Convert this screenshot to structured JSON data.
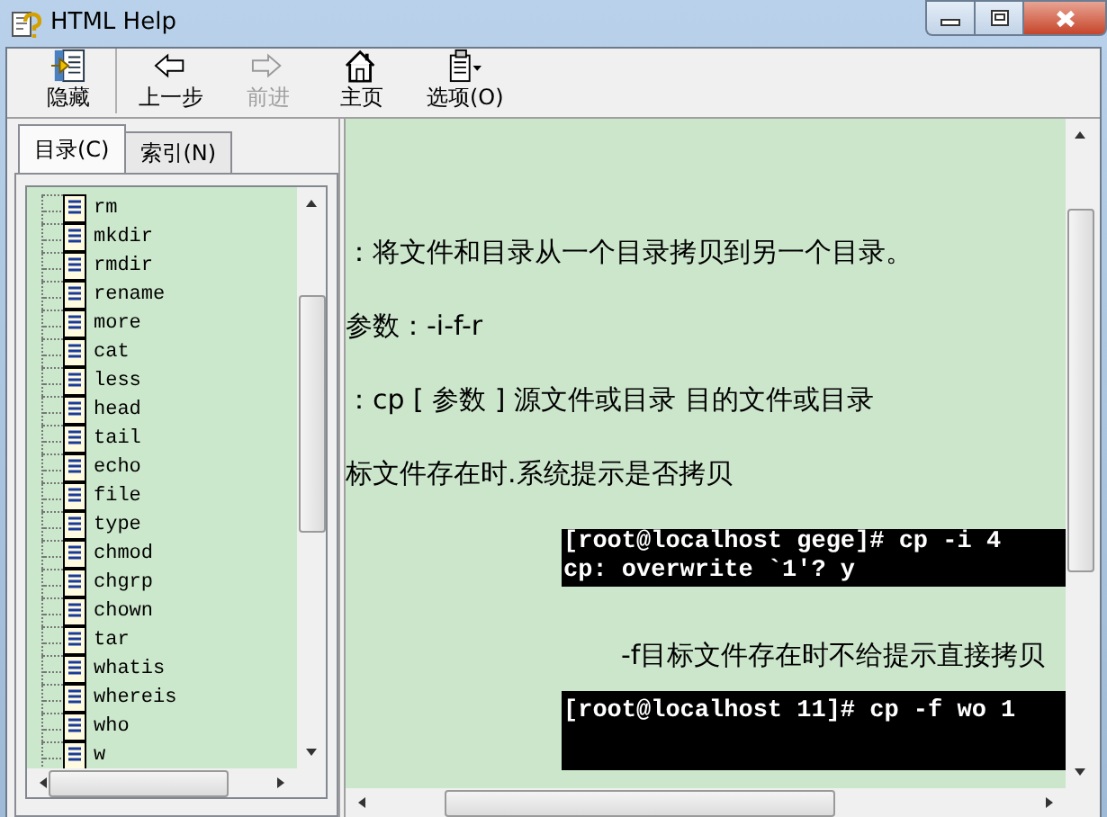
{
  "window": {
    "title": "HTML Help"
  },
  "toolbar": [
    {
      "kind": "hide",
      "label": "隐藏",
      "disabled": false
    },
    {
      "kind": "back",
      "label": "上一步",
      "disabled": false
    },
    {
      "kind": "forward",
      "label": "前进",
      "disabled": true
    },
    {
      "kind": "home",
      "label": "主页",
      "disabled": false
    },
    {
      "kind": "options",
      "label": "选项(O)",
      "disabled": false
    }
  ],
  "tabs": [
    {
      "label": "目录(C)",
      "selected": true
    },
    {
      "label": "索引(N)",
      "selected": false
    }
  ],
  "tree": {
    "items": [
      {
        "label": "rm"
      },
      {
        "label": "mkdir"
      },
      {
        "label": "rmdir"
      },
      {
        "label": "rename"
      },
      {
        "label": "more"
      },
      {
        "label": "cat"
      },
      {
        "label": "less"
      },
      {
        "label": "head"
      },
      {
        "label": "tail"
      },
      {
        "label": "echo"
      },
      {
        "label": "file"
      },
      {
        "label": "type"
      },
      {
        "label": "chmod"
      },
      {
        "label": "chgrp"
      },
      {
        "label": "chown"
      },
      {
        "label": "tar"
      },
      {
        "label": "whatis"
      },
      {
        "label": "whereis"
      },
      {
        "label": "who"
      },
      {
        "label": "w"
      }
    ]
  },
  "topic": {
    "blocks": [
      {
        "kind": "text",
        "text": "：将文件和目录从一个目录拷贝到另一个目录。"
      },
      {
        "kind": "text",
        "text": "参数：-i-f-r"
      },
      {
        "kind": "text",
        "text": "：cp [ 参数 ] 源文件或目录  目的文件或目录"
      },
      {
        "kind": "text",
        "text": "标文件存在时.系统提示是否拷贝"
      },
      {
        "kind": "terminal",
        "lines": [
          "[root@localhost gege]# cp -i 4",
          "cp: overwrite `1'? y"
        ]
      },
      {
        "kind": "indented",
        "text": "-f目标文件存在时不给提示直接拷贝"
      },
      {
        "kind": "terminal",
        "lines": [
          "[root@localhost 11]# cp -f wo 1"
        ]
      }
    ]
  }
}
